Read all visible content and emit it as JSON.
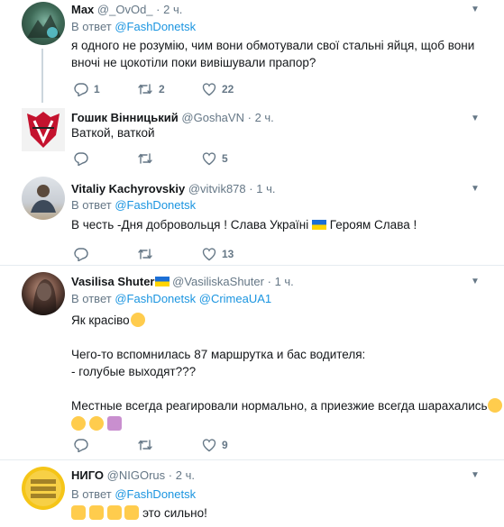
{
  "tweets": [
    {
      "name": "Max",
      "handle": "@_OvOd_",
      "time": "2 ч.",
      "reply_prefix": "В ответ",
      "reply_to": [
        "@FashDonetsk"
      ],
      "text": [
        "я одного не розумію, чим вони обмотували свої стальні яйця, щоб вони",
        "вночі не цокотіли поки вивішували прапор?"
      ],
      "replies": "1",
      "retweets": "2",
      "likes": "22"
    },
    {
      "name": "Гошик Вінницький",
      "handle": "@GoshaVN",
      "time": "2 ч.",
      "text": [
        "Ваткой, ваткой"
      ],
      "replies": "",
      "retweets": "",
      "likes": "5"
    },
    {
      "name": "Vitaliy Kachyrovskiy",
      "handle": "@vitvik878",
      "time": "1 ч.",
      "reply_prefix": "В ответ",
      "reply_to": [
        "@FashDonetsk"
      ],
      "text_a": "В честь -Дня добровольця ! Слава Україні",
      "text_b": "Героям Слава !",
      "replies": "",
      "retweets": "",
      "likes": "13"
    },
    {
      "name": "Vasilisa Shuter",
      "handle": "@VasiliskaShuter",
      "time": "1 ч.",
      "reply_prefix": "В ответ",
      "reply_to": [
        "@FashDonetsk",
        "@CrimeaUA1"
      ],
      "line1": "Як красіво",
      "line2": "Чего-то вспомнилась 87 маршрутка и бас водителя:",
      "line3": "- голубые выходят???",
      "line4": "Местные всегда реагировали нормально, а приезжие всегда шарахались",
      "replies": "",
      "retweets": "",
      "likes": "9"
    },
    {
      "name": "НИГО",
      "handle": "@NIGOrus",
      "time": "2 ч.",
      "reply_prefix": "В ответ",
      "reply_to": [
        "@FashDonetsk"
      ],
      "text": "это сильно!"
    }
  ],
  "dot": "·",
  "colors": {
    "link": "#1b95e0",
    "muted": "#657786",
    "separator": "#e6ecf0",
    "thread_line": "#ccd6dd"
  },
  "icons": [
    "reply-icon",
    "retweet-icon",
    "like-icon",
    "chevron-down-icon"
  ]
}
